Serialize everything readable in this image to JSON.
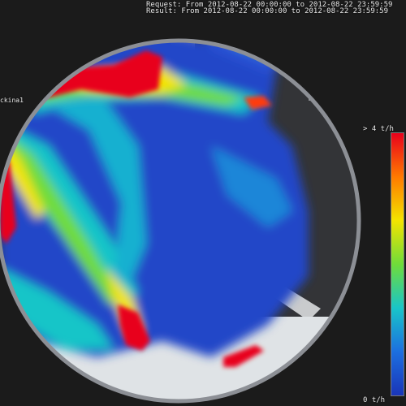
{
  "header": {
    "request_line": "Request: From 2012-08-22 00:00:00 to 2012-08-22 23:59:59",
    "result_line": "Result: From 2012-08-22 00:00:00 to 2012-08-22 23:59:59"
  },
  "camera_label": "ckina1",
  "legend": {
    "max_label": "> 4 t/h",
    "min_label": "0 t/h",
    "colors": [
      "#e8001c",
      "#ff7a00",
      "#f3e400",
      "#6fdc3a",
      "#19c5c8",
      "#1c6fe0",
      "#1a35b8"
    ]
  },
  "heatmap": {
    "background": "#1b1b1b",
    "lens_color": "#2a2a2a",
    "ring_color": "#8c8f95",
    "low_color": "#2447c8"
  }
}
